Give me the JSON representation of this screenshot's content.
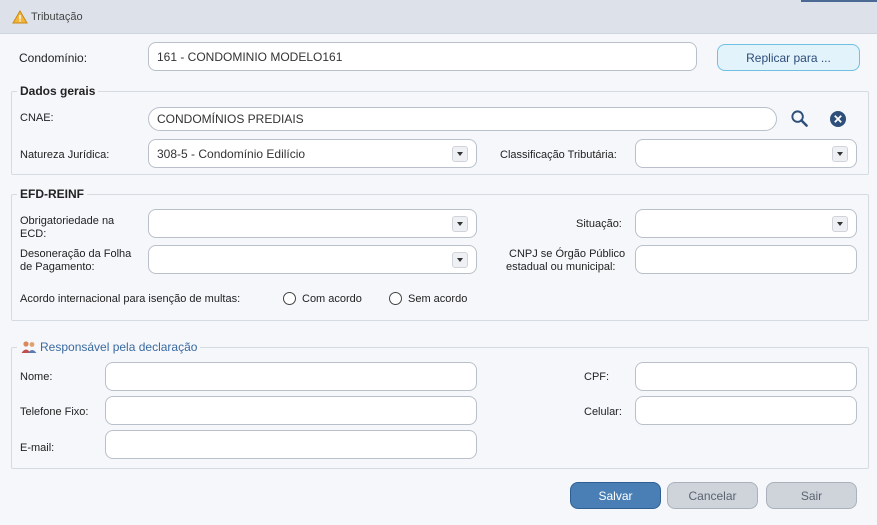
{
  "window": {
    "title": "Tributação",
    "icon": "warning-triangle-icon"
  },
  "condominio": {
    "label": "Condomínio:",
    "value": "161 - CONDOMINIO MODELO161"
  },
  "replicar_label": "Replicar para ...",
  "dados_gerais": {
    "title": "Dados gerais",
    "cnae_label": "CNAE:",
    "cnae_value": "CONDOMÍNIOS PREDIAIS",
    "natureza_label": "Natureza Jurídica:",
    "natureza_value": "308-5 - Condomínio Edilício",
    "classificacao_label": "Classificação Tributária:",
    "classificacao_value": ""
  },
  "efd_reinf": {
    "title": "EFD-REINF",
    "obrigatoriedade_label_1": "Obrigatoriedade na",
    "obrigatoriedade_label_2": "ECD:",
    "situacao_label": "Situação:",
    "desoneracao_label_1": "Desoneração da Folha",
    "desoneracao_label_2": "de Pagamento:",
    "cnpj_label_1": "CNPJ se Órgão Público",
    "cnpj_label_2": "estadual ou municipal:",
    "acordo_label": "Acordo internacional para isenção de multas:",
    "com_acordo": "Com acordo",
    "sem_acordo": "Sem acordo"
  },
  "responsavel": {
    "title": "Responsável pela declaração",
    "icon": "users-icon",
    "nome_label": "Nome:",
    "cpf_label": "CPF:",
    "telefone_label": "Telefone Fixo:",
    "celular_label": "Celular:",
    "email_label": "E-mail:"
  },
  "actions": {
    "salvar": "Salvar",
    "cancelar": "Cancelar",
    "sair": "Sair"
  },
  "colors": {
    "primary": "#4a7fb5",
    "accent": "#6fc0e3",
    "title_bar": "#dde2ea"
  }
}
